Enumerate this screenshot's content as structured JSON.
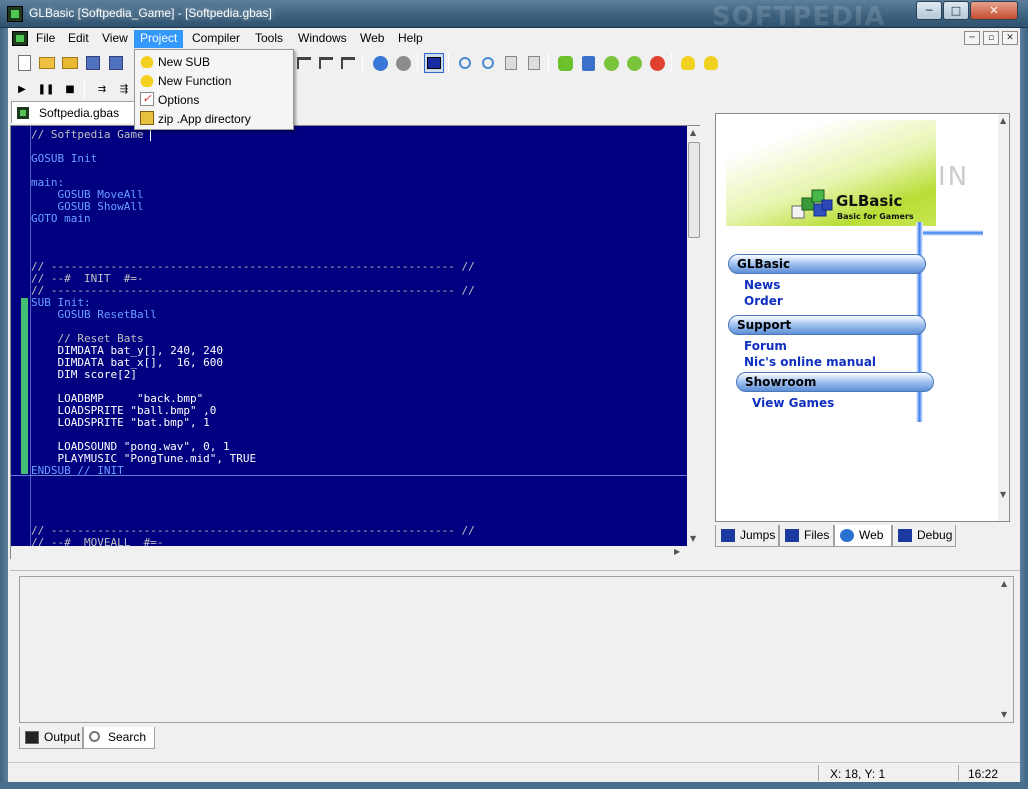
{
  "window": {
    "title": "GLBasic [Softpedia_Game] - [Softpedia.gbas]",
    "watermark": "SOFTPEDIA",
    "controls": [
      "─",
      "□",
      "✕"
    ]
  },
  "menubar": {
    "items": [
      "File",
      "Edit",
      "View",
      "Project",
      "Compiler",
      "Tools",
      "Windows",
      "Web",
      "Help"
    ],
    "active": "Project"
  },
  "project_menu": {
    "items": [
      {
        "label": "New SUB",
        "icon": "new-sub-icon"
      },
      {
        "label": "New Function",
        "icon": "new-function-icon"
      },
      {
        "label": "Options",
        "icon": "options-checkbox-icon"
      },
      {
        "label": "zip .App directory",
        "icon": "zip-directory-icon"
      }
    ]
  },
  "editor": {
    "tab_label": "Softpedia.gbas",
    "lines": [
      {
        "t": "// Softpedia Game",
        "c": "comment"
      },
      {
        "t": "",
        "c": "txt"
      },
      {
        "t": "GOSUB Init",
        "c": "kw"
      },
      {
        "t": "",
        "c": "txt"
      },
      {
        "t": "main:",
        "c": "label"
      },
      {
        "t": "    GOSUB MoveAll",
        "c": "kw"
      },
      {
        "t": "    GOSUB ShowAll",
        "c": "kw"
      },
      {
        "t": "GOTO main",
        "c": "kw"
      },
      {
        "t": "",
        "c": "txt"
      },
      {
        "t": "",
        "c": "txt"
      },
      {
        "t": "",
        "c": "txt"
      },
      {
        "t": "// ------------------------------------------------------------- //",
        "c": "comment"
      },
      {
        "t": "// --#  INIT  #=-",
        "c": "comment"
      },
      {
        "t": "// ------------------------------------------------------------- //",
        "c": "comment"
      },
      {
        "t": "SUB Init:",
        "c": "kw"
      },
      {
        "t": "    GOSUB ResetBall",
        "c": "kw"
      },
      {
        "t": "",
        "c": "txt"
      },
      {
        "t": "    // Reset Bats",
        "c": "comment"
      },
      {
        "t": "    DIMDATA bat_y[], 240, 240",
        "c": "txt"
      },
      {
        "t": "    DIMDATA bat_x[],  16, 600",
        "c": "txt"
      },
      {
        "t": "    DIM score[2]",
        "c": "txt"
      },
      {
        "t": "",
        "c": "txt"
      },
      {
        "t": "    LOADBMP     \"back.bmp\"",
        "c": "txt"
      },
      {
        "t": "    LOADSPRITE \"ball.bmp\" ,0",
        "c": "txt"
      },
      {
        "t": "    LOADSPRITE \"bat.bmp\", 1",
        "c": "txt"
      },
      {
        "t": "",
        "c": "txt"
      },
      {
        "t": "    LOADSOUND \"pong.wav\", 0, 1",
        "c": "txt"
      },
      {
        "t": "    PLAYMUSIC \"PongTune.mid\", TRUE",
        "c": "txt"
      },
      {
        "t": "ENDSUB // INIT",
        "c": "kw"
      },
      {
        "t": "",
        "c": "txt"
      },
      {
        "t": "",
        "c": "txt"
      },
      {
        "t": "",
        "c": "txt"
      },
      {
        "t": "",
        "c": "txt"
      },
      {
        "t": "// ------------------------------------------------------------- //",
        "c": "comment"
      },
      {
        "t": "// --#  MOVEALL  #=-",
        "c": "comment"
      },
      {
        "t": "// ------------------------------------------------------------- //",
        "c": "comment"
      }
    ]
  },
  "web_panel": {
    "brand": "GLBasic",
    "tagline": "Basic for Gamers",
    "grey_text": "IN",
    "sections": [
      {
        "header": "GLBasic",
        "links": [
          "News",
          "Order"
        ]
      },
      {
        "header": "Support",
        "links": [
          "Forum",
          "Nic's online manual"
        ]
      },
      {
        "header": "Showroom",
        "links": [
          "View Games"
        ]
      }
    ]
  },
  "right_tabs": [
    {
      "label": "Jumps",
      "active": false
    },
    {
      "label": "Files",
      "active": false
    },
    {
      "label": "Web",
      "active": true
    },
    {
      "label": "Debug",
      "active": false
    }
  ],
  "bottom_tabs": [
    {
      "label": "Output",
      "active": false
    },
    {
      "label": "Search",
      "active": true
    }
  ],
  "statusbar": {
    "position": "X: 18, Y:  1",
    "time": "16:22"
  },
  "colors": {
    "editor_bg": "#000080",
    "keyword": "#6aa0ff",
    "comment": "#c0c0c0",
    "menu_highlight": "#3399ff",
    "link": "#1030c0"
  }
}
